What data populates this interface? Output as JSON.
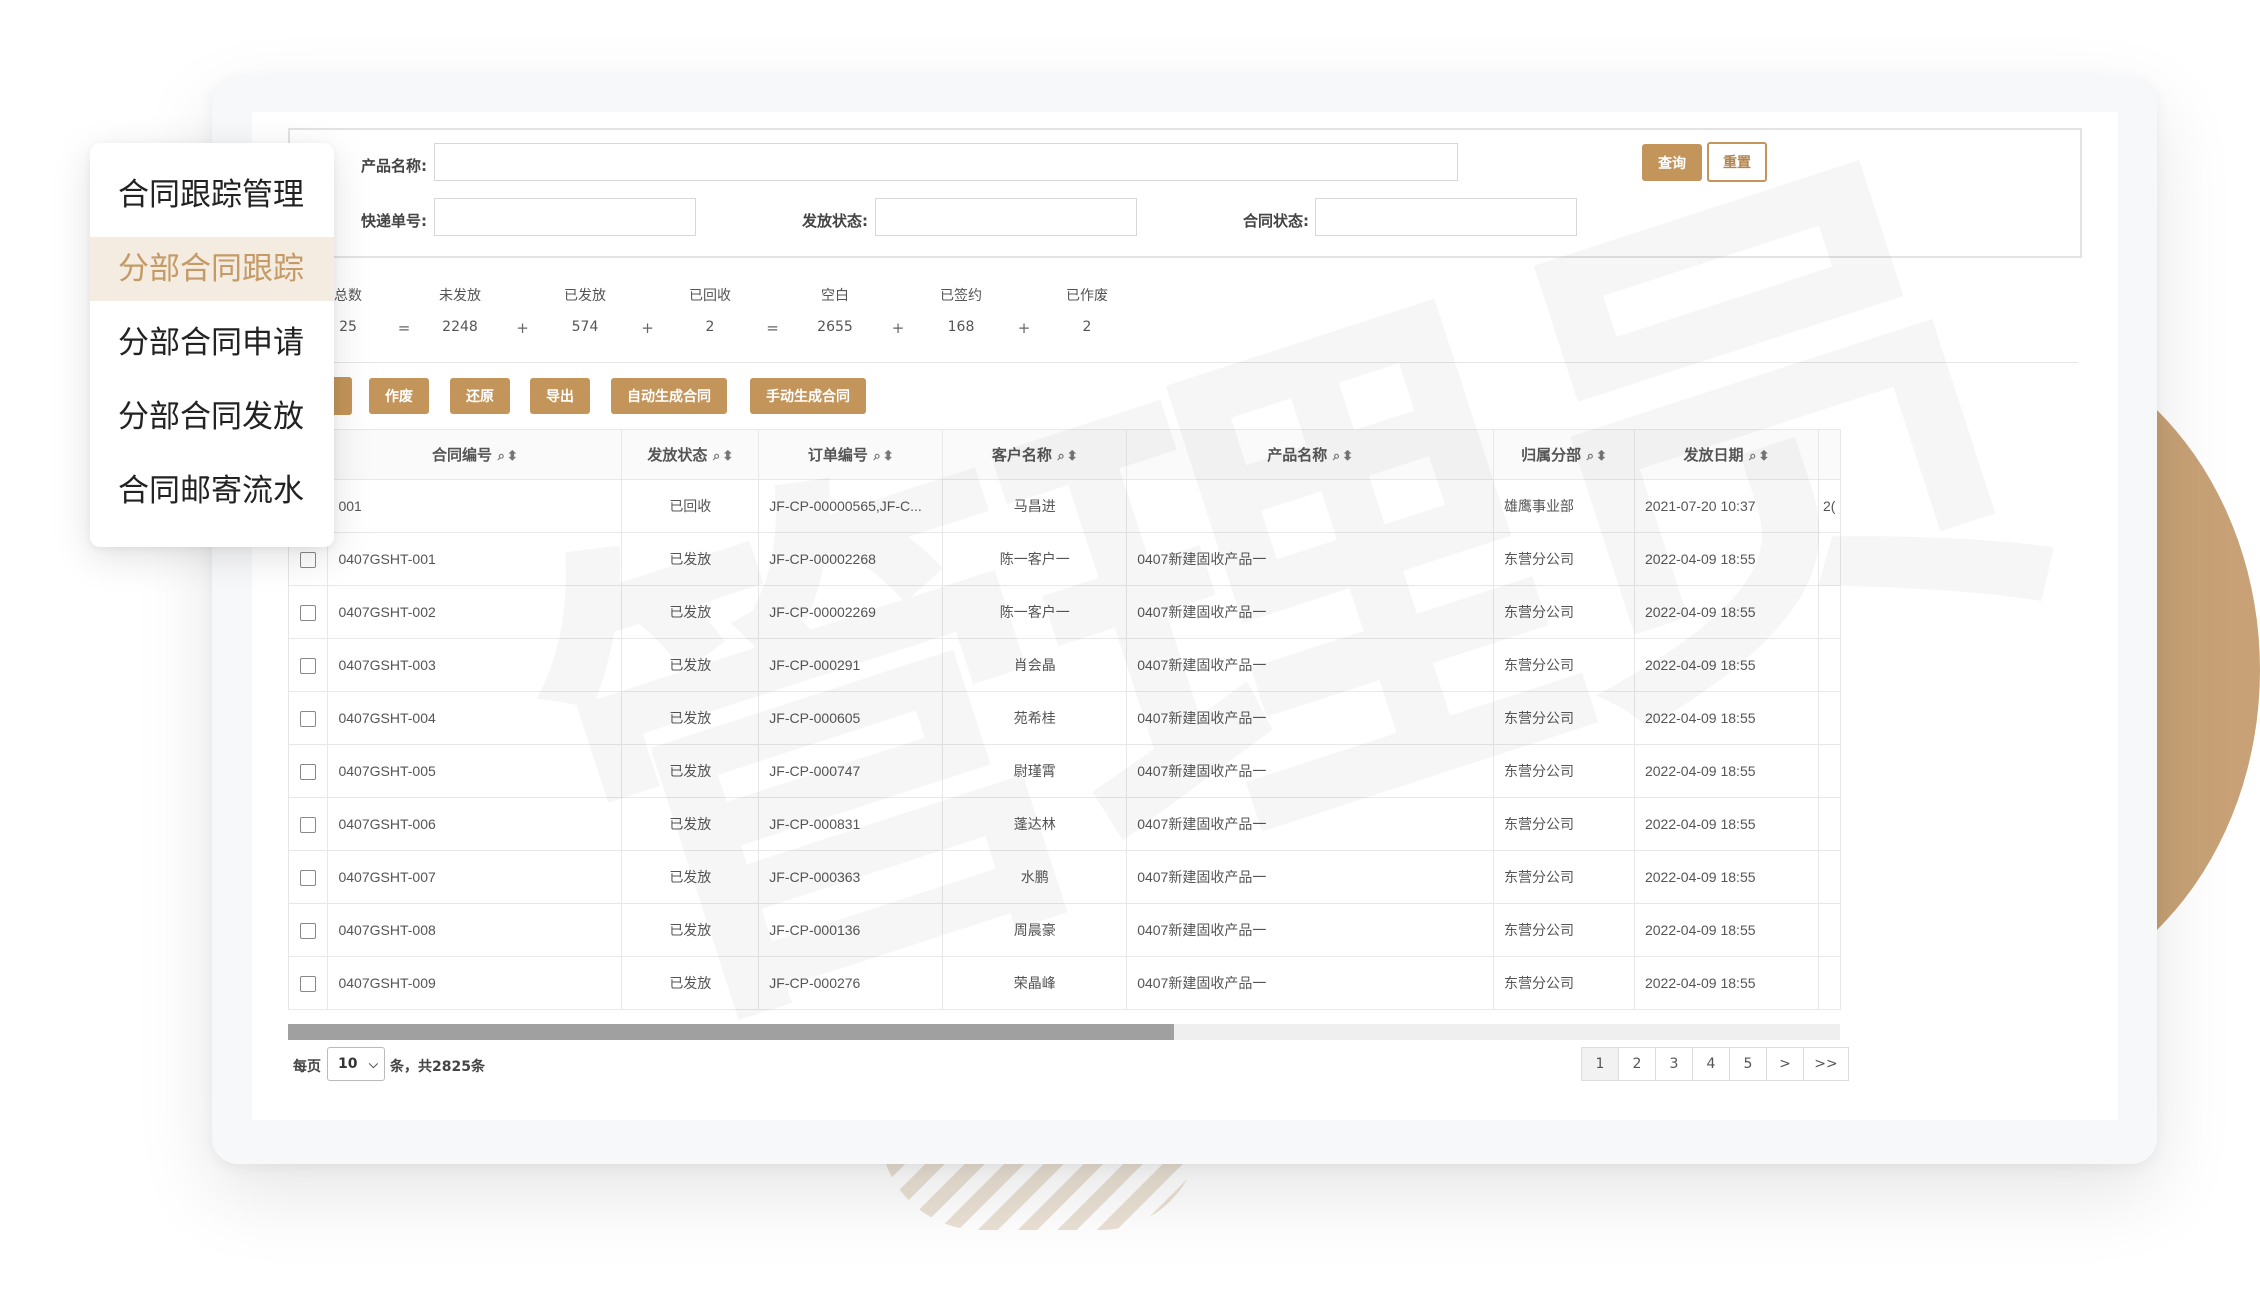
{
  "menu": {
    "items": [
      {
        "label": "合同跟踪管理"
      },
      {
        "label": "分部合同跟踪"
      },
      {
        "label": "分部合同申请"
      },
      {
        "label": "分部合同发放"
      },
      {
        "label": "合同邮寄流水"
      }
    ],
    "active_index": 1
  },
  "search": {
    "product_name_label": "产品名称:",
    "product_name_value": "",
    "express_no_label": "快递单号:",
    "express_no_value": "",
    "send_status_label": "发放状态:",
    "send_status_value": "",
    "contract_status_label": "合同状态:",
    "contract_status_value": "",
    "query_label": "查询",
    "reset_label": "重置"
  },
  "stats": {
    "items": [
      {
        "label": "总数",
        "value": "25"
      },
      {
        "label": "未发放",
        "value": "2248"
      },
      {
        "label": "已发放",
        "value": "574"
      },
      {
        "label": "已回收",
        "value": "2"
      },
      {
        "label": "空白",
        "value": "2655"
      },
      {
        "label": "已签约",
        "value": "168"
      },
      {
        "label": "已作废",
        "value": "2"
      }
    ],
    "ops": [
      "=",
      "+",
      "+",
      "=",
      "+",
      "+"
    ]
  },
  "toolbar": {
    "void_label": "作废",
    "restore_label": "还原",
    "export_label": "导出",
    "auto_gen_label": "自动生成合同",
    "manual_gen_label": "手动生成合同"
  },
  "table": {
    "headers": [
      "合同编号",
      "发放状态",
      "订单编号",
      "客户名称",
      "产品名称",
      "归属分部",
      "发放日期"
    ],
    "rows": [
      {
        "contract_no": "001",
        "status": "已回收",
        "order_no": "JF-CP-00000565,JF-C...",
        "customer": "马昌进",
        "product": "",
        "branch": "雄鹰事业部",
        "date": "2021-07-20 10:37",
        "extra": "2("
      },
      {
        "contract_no": "0407GSHT-001",
        "status": "已发放",
        "order_no": "JF-CP-00002268",
        "customer": "陈一客户一",
        "product": "0407新建固收产品一",
        "branch": "东营分公司",
        "date": "2022-04-09 18:55",
        "extra": ""
      },
      {
        "contract_no": "0407GSHT-002",
        "status": "已发放",
        "order_no": "JF-CP-00002269",
        "customer": "陈一客户一",
        "product": "0407新建固收产品一",
        "branch": "东营分公司",
        "date": "2022-04-09 18:55",
        "extra": ""
      },
      {
        "contract_no": "0407GSHT-003",
        "status": "已发放",
        "order_no": "JF-CP-000291",
        "customer": "肖会晶",
        "product": "0407新建固收产品一",
        "branch": "东营分公司",
        "date": "2022-04-09 18:55",
        "extra": ""
      },
      {
        "contract_no": "0407GSHT-004",
        "status": "已发放",
        "order_no": "JF-CP-000605",
        "customer": "苑希桂",
        "product": "0407新建固收产品一",
        "branch": "东营分公司",
        "date": "2022-04-09 18:55",
        "extra": ""
      },
      {
        "contract_no": "0407GSHT-005",
        "status": "已发放",
        "order_no": "JF-CP-000747",
        "customer": "尉瑾霄",
        "product": "0407新建固收产品一",
        "branch": "东营分公司",
        "date": "2022-04-09 18:55",
        "extra": ""
      },
      {
        "contract_no": "0407GSHT-006",
        "status": "已发放",
        "order_no": "JF-CP-000831",
        "customer": "蓬达林",
        "product": "0407新建固收产品一",
        "branch": "东营分公司",
        "date": "2022-04-09 18:55",
        "extra": ""
      },
      {
        "contract_no": "0407GSHT-007",
        "status": "已发放",
        "order_no": "JF-CP-000363",
        "customer": "水鹏",
        "product": "0407新建固收产品一",
        "branch": "东营分公司",
        "date": "2022-04-09 18:55",
        "extra": ""
      },
      {
        "contract_no": "0407GSHT-008",
        "status": "已发放",
        "order_no": "JF-CP-000136",
        "customer": "周晨豪",
        "product": "0407新建固收产品一",
        "branch": "东营分公司",
        "date": "2022-04-09 18:55",
        "extra": ""
      },
      {
        "contract_no": "0407GSHT-009",
        "status": "已发放",
        "order_no": "JF-CP-000276",
        "customer": "荣晶峰",
        "product": "0407新建固收产品一",
        "branch": "东营分公司",
        "date": "2022-04-09 18:55",
        "extra": ""
      }
    ]
  },
  "pagination": {
    "per_page_label": "每页",
    "per_page_value": "10",
    "total_label": "条，共2825条",
    "pages": [
      "1",
      "2",
      "3",
      "4",
      "5",
      ">",
      ">>"
    ],
    "current": "1"
  },
  "watermark": "管理员",
  "colors": {
    "accent": "#c4955a",
    "menu_active_bg": "#f4ece1",
    "menu_active_text": "#c49a66"
  }
}
